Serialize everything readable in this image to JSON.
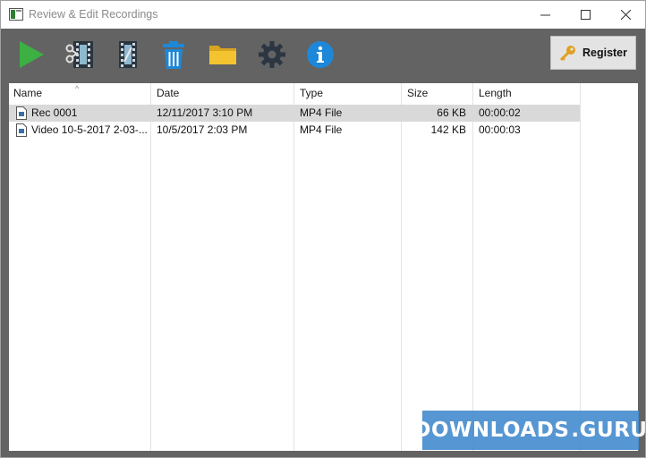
{
  "window": {
    "title": "Review & Edit Recordings"
  },
  "toolbar": {
    "items": [
      {
        "icon": "play-icon"
      },
      {
        "icon": "film-edit-icon"
      },
      {
        "icon": "film-trim-icon"
      },
      {
        "icon": "trash-icon"
      },
      {
        "icon": "folder-icon"
      },
      {
        "icon": "gear-icon"
      },
      {
        "icon": "info-icon"
      }
    ],
    "register_label": "Register"
  },
  "list": {
    "columns": [
      "Name",
      "Date",
      "Type",
      "Size",
      "Length"
    ],
    "sort_column": "Name",
    "rows": [
      {
        "name": "Rec 0001",
        "date": "12/11/2017 3:10 PM",
        "type": "MP4 File",
        "size": "66 KB",
        "length": "00:00:02",
        "selected": true
      },
      {
        "name": "Video 10-5-2017 2-03-...",
        "date": "10/5/2017 2:03 PM",
        "type": "MP4 File",
        "size": "142 KB",
        "length": "00:00:03",
        "selected": false
      }
    ]
  },
  "watermark": {
    "left": "DOWNLOADS",
    "right": ".GURU"
  },
  "colors": {
    "toolbar_bg": "#636363",
    "play": "#3cb043",
    "trash": "#1e88d8",
    "folder": "#f4c430",
    "info": "#1e88d8",
    "selected_row": "#d9d9d9",
    "watermark_bg": "#4a8fcf"
  }
}
